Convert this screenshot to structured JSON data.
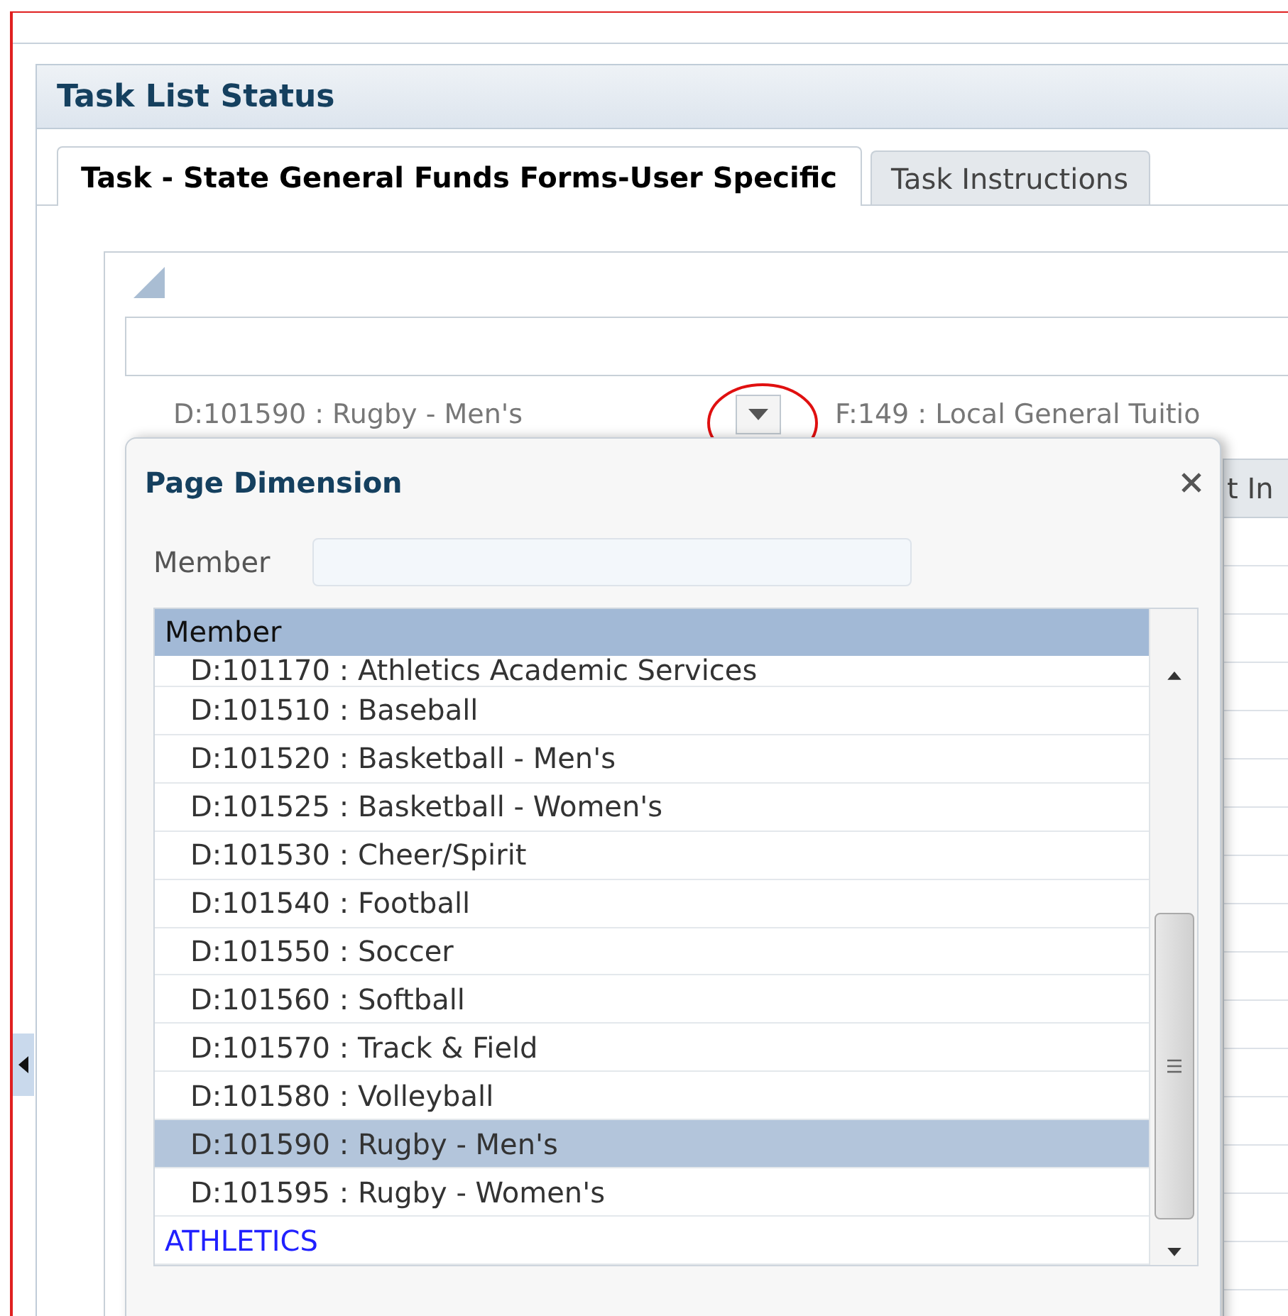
{
  "panel": {
    "title": "Task List Status"
  },
  "tabs": [
    {
      "label": "Task - State General Funds Forms-User Specific",
      "selected": true
    },
    {
      "label": "Task Instructions",
      "selected": false
    }
  ],
  "dimension_bar": {
    "current": "D:101590 : Rugby - Men's",
    "next": "F:149 : Local General Tuitio"
  },
  "background_tab": "t In",
  "dialog": {
    "title": "Page Dimension",
    "filter_label": "Member",
    "list_header": "Member",
    "rows": [
      {
        "label": "D:101170 : Athletics Academic Services",
        "kind": "member",
        "selected": false
      },
      {
        "label": "D:101510 : Baseball",
        "kind": "member",
        "selected": false
      },
      {
        "label": "D:101520 : Basketball - Men's",
        "kind": "member",
        "selected": false
      },
      {
        "label": "D:101525 : Basketball - Women's",
        "kind": "member",
        "selected": false
      },
      {
        "label": "D:101530 : Cheer/Spirit",
        "kind": "member",
        "selected": false
      },
      {
        "label": "D:101540 : Football",
        "kind": "member",
        "selected": false
      },
      {
        "label": "D:101550 : Soccer",
        "kind": "member",
        "selected": false
      },
      {
        "label": "D:101560 : Softball",
        "kind": "member",
        "selected": false
      },
      {
        "label": "D:101570 : Track & Field",
        "kind": "member",
        "selected": false
      },
      {
        "label": "D:101580 : Volleyball",
        "kind": "member",
        "selected": false
      },
      {
        "label": "D:101590 : Rugby - Men's",
        "kind": "member",
        "selected": true
      },
      {
        "label": "D:101595 : Rugby - Women's",
        "kind": "member",
        "selected": false
      },
      {
        "label": "ATHLETICS",
        "kind": "parent",
        "selected": false
      }
    ]
  }
}
